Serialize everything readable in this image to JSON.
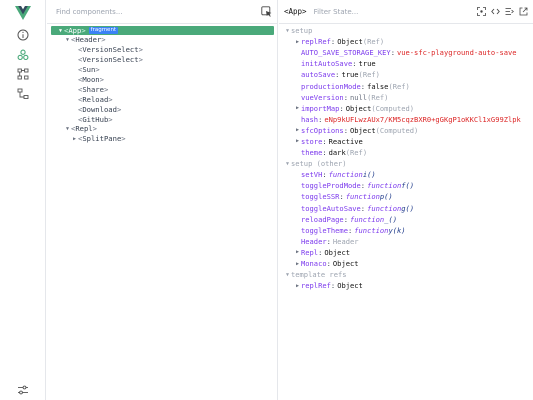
{
  "tree": {
    "search_placeholder": "Find components...",
    "nodes": [
      {
        "label": "App",
        "badge": "fragment",
        "arrow": "▼",
        "depth": 0,
        "selected": true
      },
      {
        "label": "Header",
        "arrow": "▼",
        "depth": 1
      },
      {
        "label": "VersionSelect",
        "arrow": "",
        "depth": 2
      },
      {
        "label": "VersionSelect",
        "arrow": "",
        "depth": 2
      },
      {
        "label": "Sun",
        "arrow": "",
        "depth": 2
      },
      {
        "label": "Moon",
        "arrow": "",
        "depth": 2
      },
      {
        "label": "Share",
        "arrow": "",
        "depth": 2
      },
      {
        "label": "Reload",
        "arrow": "",
        "depth": 2
      },
      {
        "label": "Download",
        "arrow": "",
        "depth": 2
      },
      {
        "label": "GitHub",
        "arrow": "",
        "depth": 2
      },
      {
        "label": "Repl",
        "arrow": "▼",
        "depth": 1
      },
      {
        "label": "SplitPane",
        "arrow": "▶",
        "depth": 2
      }
    ]
  },
  "inspector": {
    "title": "<App>",
    "filter_placeholder": "Filter State...",
    "sections": [
      {
        "title": "setup",
        "props": [
          {
            "key": "replRef",
            "arrow": "▶",
            "value": "Object",
            "vclass": "v-obj",
            "suffix": "(Ref)"
          },
          {
            "key": "AUTO_SAVE_STORAGE_KEY",
            "value": "vue-sfc-playground-auto-save",
            "vclass": "v-str",
            "suffix": ""
          },
          {
            "key": "initAutoSave",
            "value": "true",
            "vclass": "v-bool",
            "suffix": ""
          },
          {
            "key": "autoSave",
            "value": "true",
            "vclass": "v-bool",
            "suffix": "(Ref)"
          },
          {
            "key": "productionMode",
            "value": "false",
            "vclass": "v-bool",
            "suffix": "(Ref)"
          },
          {
            "key": "vueVersion",
            "value": "null",
            "vclass": "v-null",
            "suffix": "(Ref)"
          },
          {
            "key": "importMap",
            "arrow": "▶",
            "value": "Object",
            "vclass": "v-obj",
            "suffix": "(Computed)"
          },
          {
            "key": "hash",
            "value": "eNp9kUFLwzAUx7/KM5cqzBXR0+gGKgP1oKKCl1xG99Zlpk",
            "vclass": "v-str",
            "suffix": ""
          },
          {
            "key": "sfcOptions",
            "arrow": "▶",
            "value": "Object",
            "vclass": "v-obj",
            "suffix": "(Computed)"
          },
          {
            "key": "store",
            "arrow": "▶",
            "value": "Reactive",
            "vclass": "v-obj",
            "suffix": ""
          },
          {
            "key": "theme",
            "value": "dark",
            "vclass": "v-obj",
            "suffix": "(Ref)"
          }
        ]
      },
      {
        "title": "setup (other)",
        "props": [
          {
            "key": "setVH",
            "fnkw": "function",
            "fnname": "i()"
          },
          {
            "key": "toggleProdMode",
            "fnkw": "function",
            "fnname": "f()"
          },
          {
            "key": "toggleSSR",
            "fnkw": "function",
            "fnname": "p()"
          },
          {
            "key": "toggleAutoSave",
            "fnkw": "function",
            "fnname": "g()"
          },
          {
            "key": "reloadPage",
            "fnkw": "function",
            "fnname": "_()"
          },
          {
            "key": "toggleTheme",
            "fnkw": "function",
            "fnname": "y(k)"
          },
          {
            "key": "Header",
            "value": "Header",
            "vclass": "v-comp",
            "suffix": ""
          },
          {
            "key": "Repl",
            "arrow": "▶",
            "value": "Object",
            "vclass": "v-obj",
            "suffix": ""
          },
          {
            "key": "Monaco",
            "arrow": "▶",
            "value": "Object",
            "vclass": "v-obj",
            "suffix": ""
          }
        ]
      },
      {
        "title": "template refs",
        "props": [
          {
            "key": "replRef",
            "arrow": "▶",
            "value": "Object",
            "vclass": "v-obj",
            "suffix": ""
          }
        ]
      }
    ]
  },
  "colors": {
    "selected_bg": "#4aa97a",
    "badge_bg": "#3b82f6",
    "key_purple": "#7c3aed",
    "string_red": "#dc2626"
  },
  "icons": {
    "logo": "vue-logo-icon",
    "activity": [
      "info-icon",
      "components-icon",
      "component-tree-icon",
      "timeline-icon",
      "settings-icon"
    ],
    "inspector_tools": [
      "scroll-to-component-icon",
      "open-in-editor-icon",
      "inspect-dom-icon",
      "open-external-icon"
    ]
  }
}
